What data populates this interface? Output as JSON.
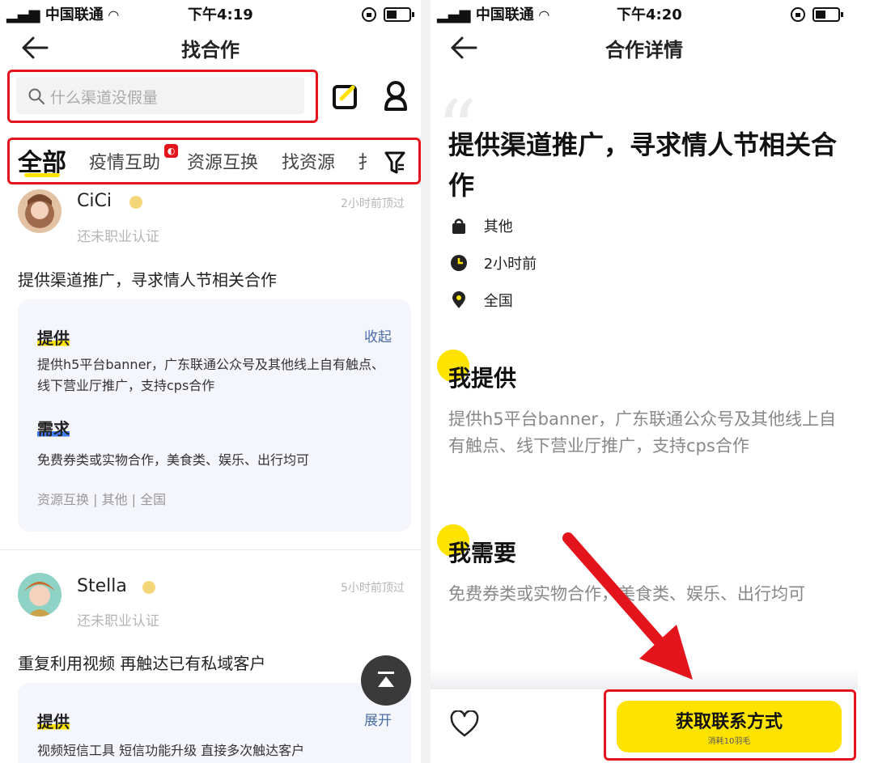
{
  "colors": {
    "accent": "#ffe300",
    "annotation": "#e3141b",
    "link": "#4a6fa5"
  },
  "left": {
    "status": {
      "carrier": "中国联通",
      "time": "下午4:19"
    },
    "nav": {
      "title": "找合作"
    },
    "search": {
      "placeholder": "什么渠道没假量"
    },
    "tabs": [
      "全部",
      "疫情互助",
      "资源互换",
      "找资源",
      "扌"
    ],
    "posts": [
      {
        "name": "CiCi",
        "cert": "还未职业认证",
        "time": "2小时前顶过",
        "title": "提供渠道推广，寻求情人节相关合作",
        "offer_label": "提供",
        "toggle": "收起",
        "offer_text": "提供h5平台banner，广东联通公众号及其他线上自有触点、线下营业厅推广，支持cps合作",
        "need_label": "需求",
        "need_text": "免费券类或实物合作，美食类、娱乐、出行均可",
        "tags": "资源互换 | 其他 | 全国"
      },
      {
        "name": "Stella",
        "cert": "还未职业认证",
        "time": "5小时前顶过",
        "title": "重复利用视频 再触达已有私域客户",
        "offer_label": "提供",
        "toggle": "展开",
        "offer_text": "视频短信工具 短信功能升级 直接多次触达客户"
      }
    ]
  },
  "right": {
    "status": {
      "carrier": "中国联通",
      "time": "下午4:20"
    },
    "nav": {
      "title": "合作详情"
    },
    "title": "提供渠道推广，寻求情人节相关合作",
    "meta": [
      {
        "icon": "lock-icon",
        "text": "其他"
      },
      {
        "icon": "clock-icon",
        "text": "2小时前"
      },
      {
        "icon": "location-pin-icon",
        "text": "全国"
      }
    ],
    "offer": {
      "heading": "我提供",
      "text": "提供h5平台banner，广东联通公众号及其他线上自有触点、线下营业厅推广，支持cps合作"
    },
    "need": {
      "heading": "我需要",
      "text": "免费券类或实物合作，美食类、娱乐、出行均可"
    },
    "cta": {
      "label": "获取联系方式",
      "sub": "消耗10羽毛"
    }
  }
}
